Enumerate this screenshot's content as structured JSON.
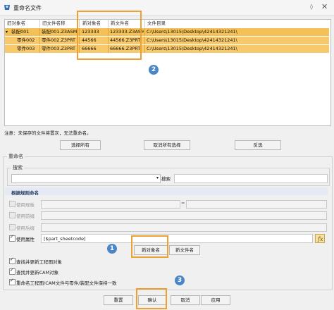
{
  "window": {
    "title": "重命名文件"
  },
  "table": {
    "headers": [
      "旧对象名",
      "旧文件名称",
      "新对象名",
      "新文件名",
      "文件目录"
    ],
    "rows": [
      {
        "old_obj": "装配001",
        "old_file": "装配001.Z3ASM",
        "new_obj": "123333",
        "new_file": "123333.Z3ASM",
        "dir": "C:\\Users\\13015\\Desktop\\42414321241\\"
      },
      {
        "old_obj": "零件002",
        "old_file": "零件002.Z3PRT",
        "new_obj": "44566",
        "new_file": "44566.Z3PRT",
        "dir": "C:\\Users\\13015\\Desktop\\42414321241\\"
      },
      {
        "old_obj": "零件003",
        "old_file": "零件003.Z3PRT",
        "new_obj": "66666",
        "new_file": "66666.Z3PRT",
        "dir": "C:\\Users\\13015\\Desktop\\42414321241\\"
      }
    ]
  },
  "note": "注意：未保存的文件将置灰，无法重命名。",
  "select_buttons": {
    "select_all": "选择所有",
    "deselect_all": "取消所有选择",
    "invert": "反选"
  },
  "rename": {
    "group_label": "重命名",
    "search": {
      "group_label": "搜索",
      "button": "搜索",
      "select_value": "",
      "input_value": ""
    },
    "rule_header": "根据规则命名",
    "use_template": "使用规板",
    "eq_sign": "=",
    "use_prefix": "使用前缀",
    "use_suffix": "使用后缀",
    "use_attr": "使用属性",
    "attr_value": "[$part_sheetcode]",
    "new_obj_button": "新对象名",
    "new_file_button": "新文件名"
  },
  "options": {
    "find_update_drawing": "查找并更新工程图对象",
    "find_update_cam": "查找并更新CAM对象",
    "keep_consistent": "重命名工程图/CAM文件与零件/装配文件保持一致"
  },
  "bottom_buttons": {
    "reset": "重置",
    "ok": "确认",
    "cancel": "取消",
    "apply": "应用"
  },
  "markers": {
    "m1": "1",
    "m2": "2",
    "m3": "3"
  },
  "colors": {
    "highlight_row": "#f3c155",
    "marker": "#4a86c8",
    "callout": "#f0a030"
  }
}
